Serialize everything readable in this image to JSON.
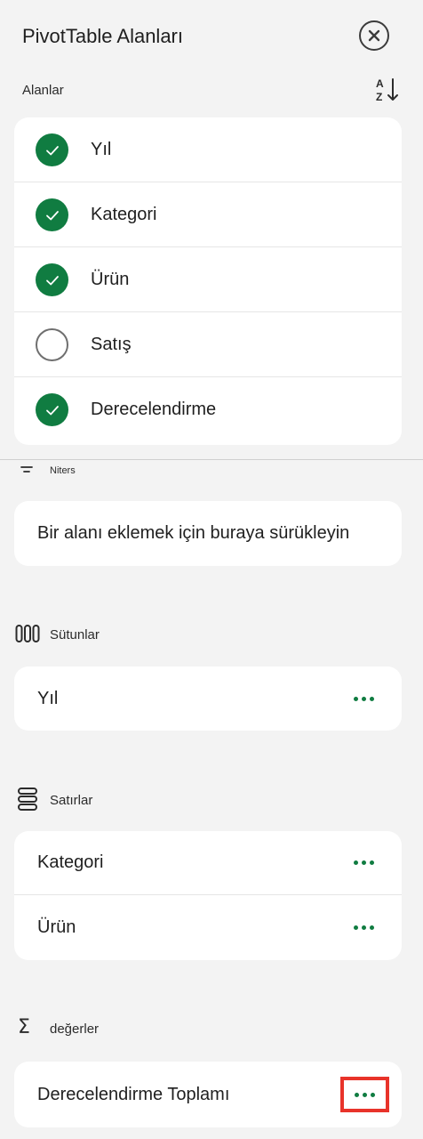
{
  "header": {
    "title": "PivotTable Alanları",
    "close_icon": "close-circle-icon"
  },
  "fields_section": {
    "label": "Alanlar",
    "sort_icon": "sort-az-icon",
    "items": [
      {
        "label": "Yıl",
        "checked": true
      },
      {
        "label": "Kategori",
        "checked": true
      },
      {
        "label": "Ürün",
        "checked": true
      },
      {
        "label": "Satış",
        "checked": false
      },
      {
        "label": "Derecelendirme",
        "checked": true
      }
    ]
  },
  "filters": {
    "label": "Niters",
    "icon": "filter-icon",
    "drop_hint": "Bir alanı eklemek için buraya sürükleyin"
  },
  "columns": {
    "label": "Sütunlar",
    "icon": "columns-icon",
    "items": [
      {
        "label": "Yıl"
      }
    ]
  },
  "rows": {
    "label": "Satırlar",
    "icon": "rows-icon",
    "items": [
      {
        "label": "Kategori"
      },
      {
        "label": "Ürün"
      }
    ]
  },
  "values": {
    "label": "değerler",
    "icon": "sigma-icon",
    "items": [
      {
        "label": "Derecelendirme Toplamı",
        "highlighted": true
      }
    ]
  },
  "colors": {
    "accent": "#107c41",
    "highlight_box": "#e8332a",
    "background": "#f3f3f3"
  }
}
